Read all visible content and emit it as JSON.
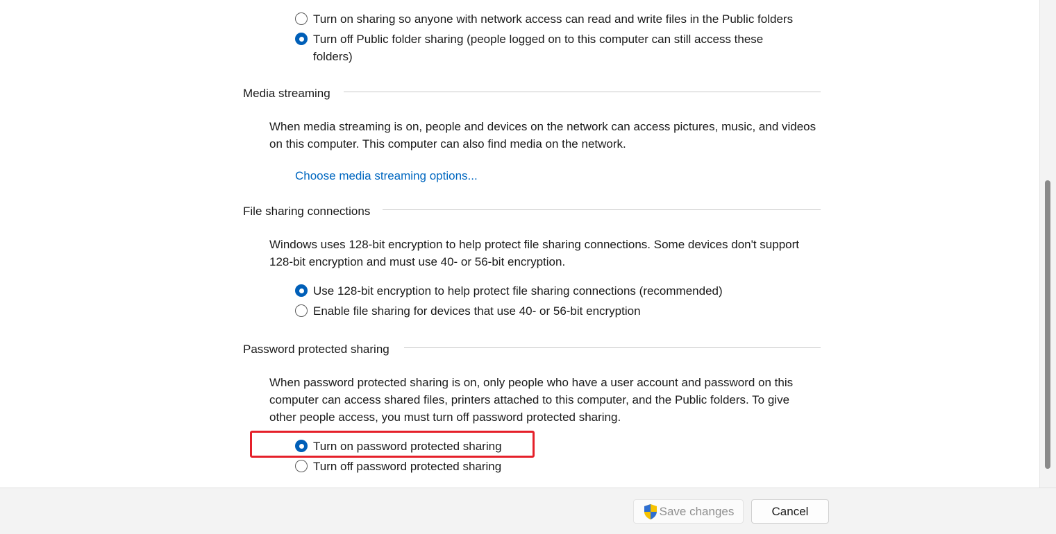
{
  "public_folder_sharing": {
    "options": [
      {
        "label": "Turn on sharing so anyone with network access can read and write files in the Public folders",
        "selected": false
      },
      {
        "label": "Turn off Public folder sharing (people logged on to this computer can still access these folders)",
        "selected": true
      }
    ]
  },
  "media_streaming": {
    "title": "Media streaming",
    "description": "When media streaming is on, people and devices on the network can access pictures, music, and videos on this computer. This computer can also find media on the network.",
    "link": "Choose media streaming options..."
  },
  "file_sharing_connections": {
    "title": "File sharing connections",
    "description": "Windows uses 128-bit encryption to help protect file sharing connections. Some devices don't support 128-bit encryption and must use 40- or 56-bit encryption.",
    "options": [
      {
        "label": "Use 128-bit encryption to help protect file sharing connections (recommended)",
        "selected": true
      },
      {
        "label": "Enable file sharing for devices that use 40- or 56-bit encryption",
        "selected": false
      }
    ]
  },
  "password_protected_sharing": {
    "title": "Password protected sharing",
    "description": "When password protected sharing is on, only people who have a user account and password on this computer can access shared files, printers attached to this computer, and the Public folders. To give other people access, you must turn off password protected sharing.",
    "options": [
      {
        "label": "Turn on password protected sharing",
        "selected": true
      },
      {
        "label": "Turn off password protected sharing",
        "selected": false
      }
    ]
  },
  "footer": {
    "save_label": "Save changes",
    "cancel_label": "Cancel"
  },
  "colors": {
    "accent": "#005fb8",
    "link": "#0067c0",
    "highlight": "#e5202a"
  }
}
